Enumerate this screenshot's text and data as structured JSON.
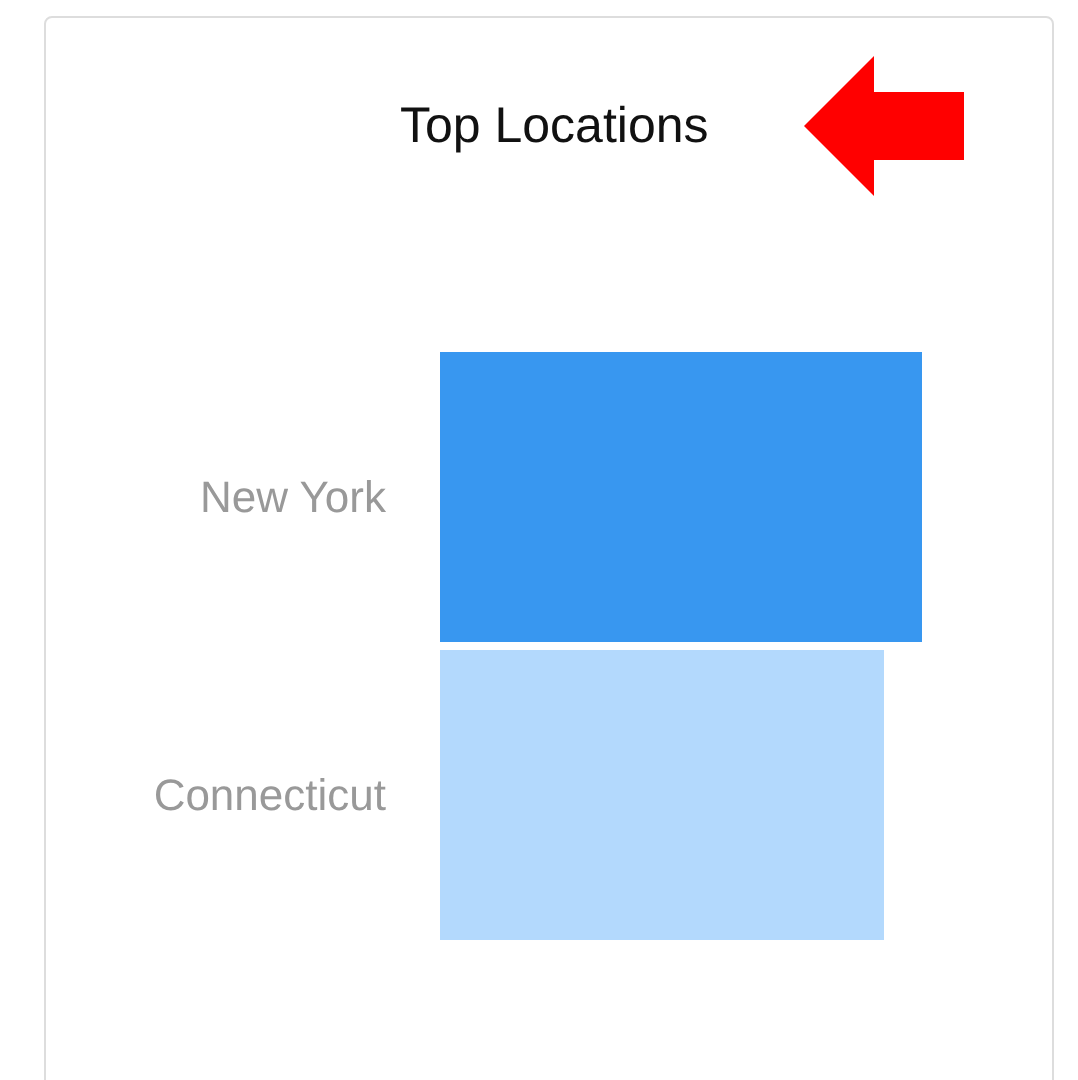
{
  "card": {
    "title": "Top Locations"
  },
  "locations": [
    {
      "label": "New York",
      "color": "#3897f0"
    },
    {
      "label": "Connecticut",
      "color": "#b3d9fd"
    }
  ]
}
